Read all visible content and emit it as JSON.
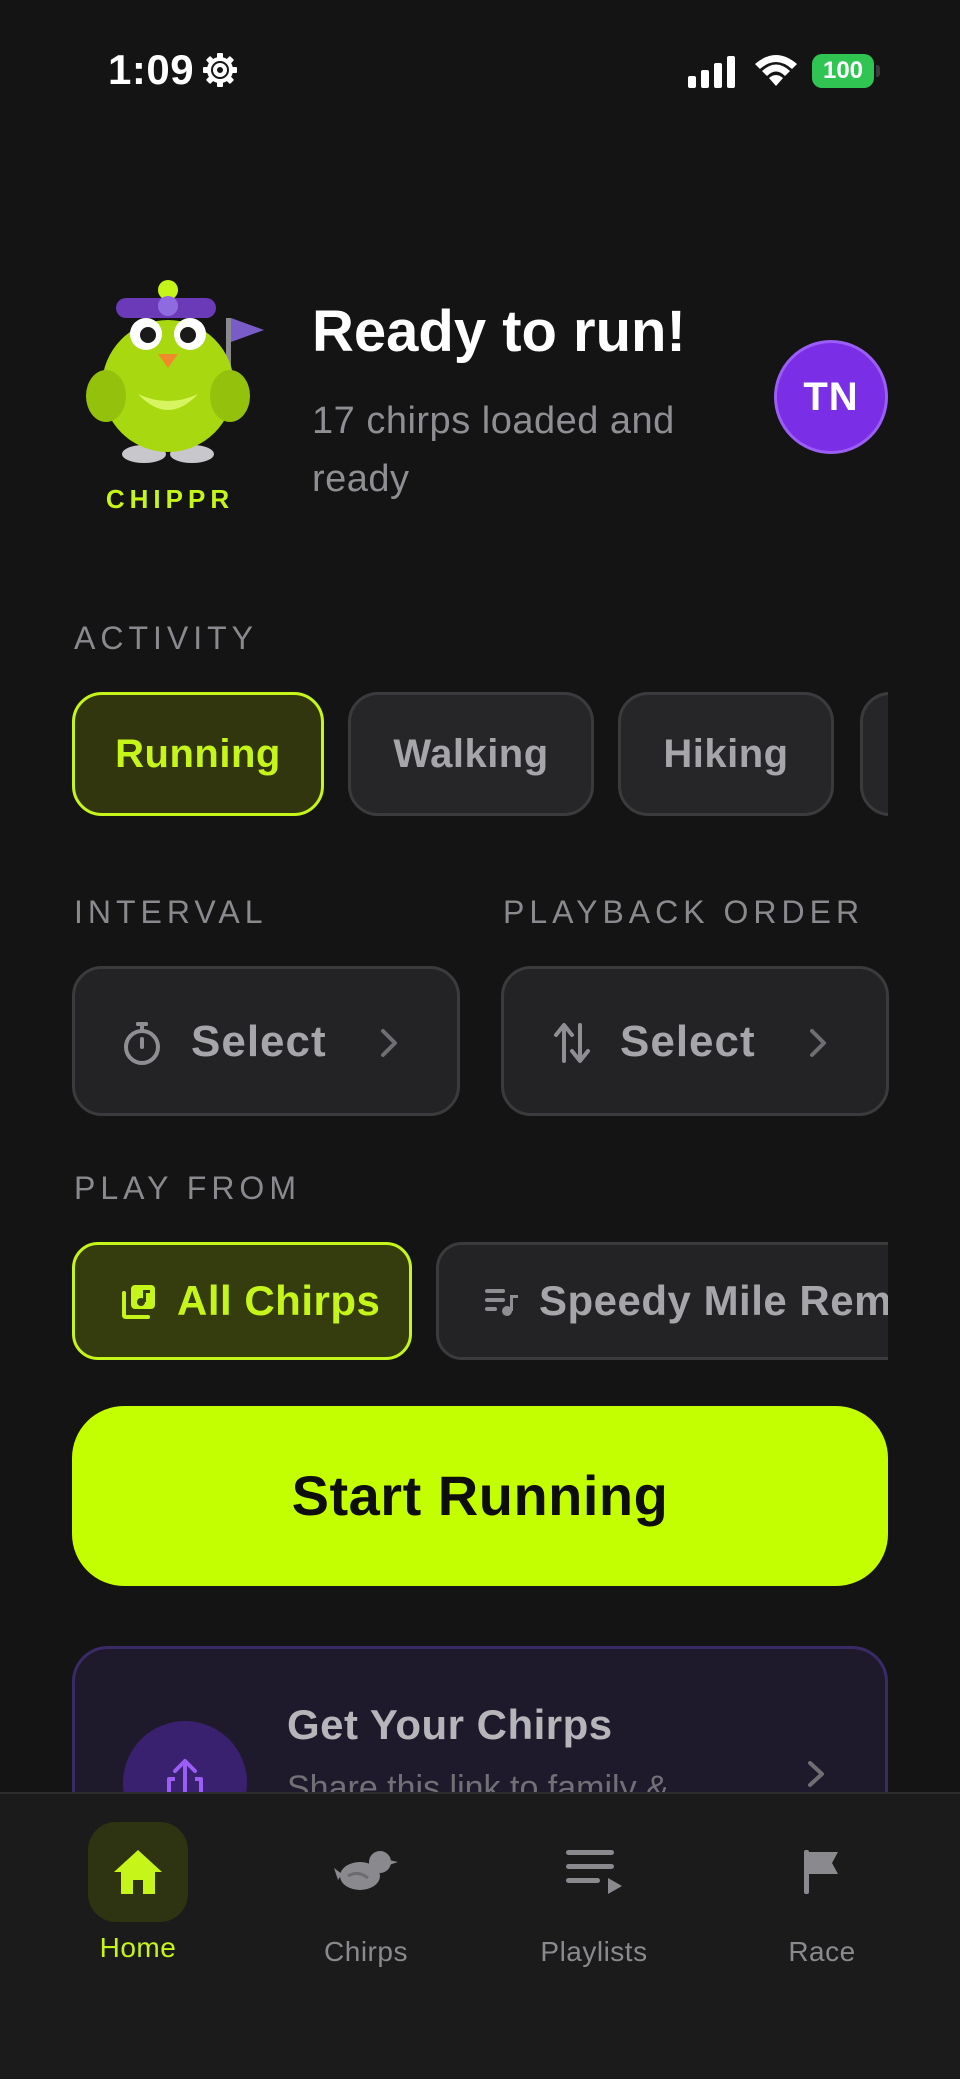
{
  "status_bar": {
    "time": "1:09",
    "battery": "100",
    "icons": [
      "gear-icon",
      "cellular-signal-icon",
      "wifi-icon",
      "battery-icon"
    ]
  },
  "header": {
    "brand": "CHIPPR",
    "title": "Ready to run!",
    "subtitle": "17 chirps loaded and ready",
    "avatar_initials": "TN"
  },
  "activity": {
    "label": "ACTIVITY",
    "options": [
      {
        "label": "Running",
        "selected": true
      },
      {
        "label": "Walking",
        "selected": false
      },
      {
        "label": "Hiking",
        "selected": false
      }
    ]
  },
  "interval": {
    "label": "INTERVAL",
    "value": "Select",
    "icon": "stopwatch-icon"
  },
  "playback_order": {
    "label": "PLAYBACK ORDER",
    "value": "Select",
    "icon": "sort-arrows-icon"
  },
  "play_from": {
    "label": "PLAY FROM",
    "options": [
      {
        "label": "All Chirps",
        "selected": true,
        "icon": "music-library-icon"
      },
      {
        "label": "Speedy Mile Remi",
        "selected": false,
        "icon": "playlist-icon"
      }
    ]
  },
  "start_button": "Start Running",
  "promo_card": {
    "title": "Get Your Chirps",
    "subtitle": "Share this link to family &",
    "icon": "share-icon"
  },
  "tabbar": {
    "tabs": [
      {
        "label": "Home",
        "icon": "home-icon",
        "active": true
      },
      {
        "label": "Chirps",
        "icon": "bird-icon",
        "active": false
      },
      {
        "label": "Playlists",
        "icon": "playlist-icon",
        "active": false
      },
      {
        "label": "Race",
        "icon": "flag-icon",
        "active": false
      }
    ]
  },
  "colors": {
    "background": "#141415",
    "accent": "#c4ff00",
    "avatar": "#7a2ee6",
    "card": "#1f1a2b"
  }
}
